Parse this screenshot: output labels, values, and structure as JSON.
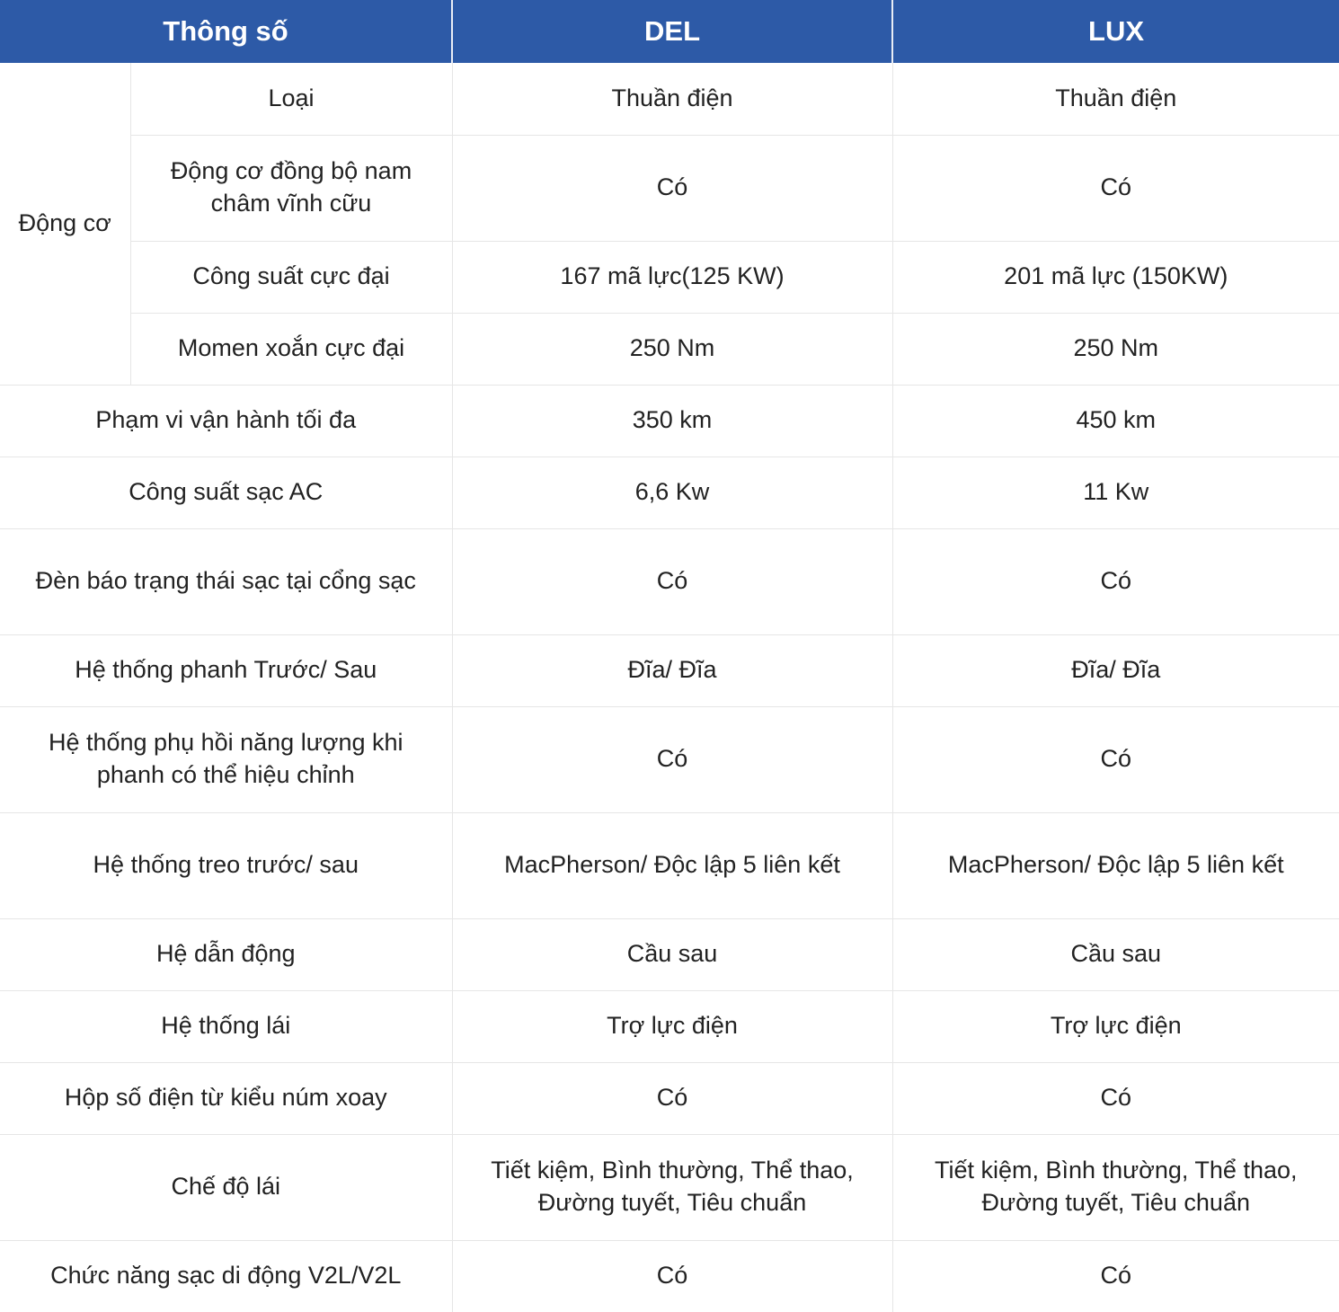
{
  "table": {
    "headers": {
      "param": "Thông số",
      "del": "DEL",
      "lux": "LUX"
    },
    "header_bg": "#2d5aa7",
    "header_text_color": "#ffffff",
    "groups": {
      "engine": "Động cơ"
    },
    "rows": [
      {
        "group": "Động cơ",
        "param": "Loại",
        "del": "Thuần điện",
        "lux": "Thuần điện"
      },
      {
        "param": "Động cơ đồng bộ nam châm vĩnh cữu",
        "del": "Có",
        "lux": "Có"
      },
      {
        "param": "Công suất cực đại",
        "del": "167 mã lực(125 KW)",
        "lux": "201 mã lực (150KW)"
      },
      {
        "param": "Momen xoắn cực đại",
        "del": "250 Nm",
        "lux": "250 Nm"
      },
      {
        "param": "Phạm vi vận hành tối đa",
        "del": "350 km",
        "lux": "450 km"
      },
      {
        "param": "Công suất sạc AC",
        "del": "6,6 Kw",
        "lux": "11 Kw"
      },
      {
        "param": "Đèn báo trạng thái sạc tại cổng sạc",
        "del": "Có",
        "lux": "Có"
      },
      {
        "param": "Hệ thống phanh Trước/ Sau",
        "del": "Đĩa/ Đĩa",
        "lux": "Đĩa/ Đĩa"
      },
      {
        "param": "Hệ thống phụ hồi năng lượng khi phanh có thể hiệu chỉnh",
        "del": "Có",
        "lux": "Có"
      },
      {
        "param": "Hệ thống treo trước/ sau",
        "del": "MacPherson/ Độc lập 5 liên kết",
        "lux": "MacPherson/ Độc lập 5 liên kết"
      },
      {
        "param": "Hệ dẫn động",
        "del": "Cầu sau",
        "lux": "Cầu sau"
      },
      {
        "param": "Hệ thống lái",
        "del": "Trợ lực điện",
        "lux": "Trợ lực điện"
      },
      {
        "param": "Hộp số điện từ kiểu núm xoay",
        "del": "Có",
        "lux": "Có"
      },
      {
        "param": "Chế độ lái",
        "del": "Tiết kiệm, Bình thường, Thể thao, Đường tuyết, Tiêu chuẩn",
        "lux": "Tiết kiệm, Bình thường, Thể thao, Đường tuyết, Tiêu chuẩn"
      },
      {
        "param": "Chức năng sạc di động V2L/V2L",
        "del": "Có",
        "lux": "Có"
      }
    ]
  }
}
